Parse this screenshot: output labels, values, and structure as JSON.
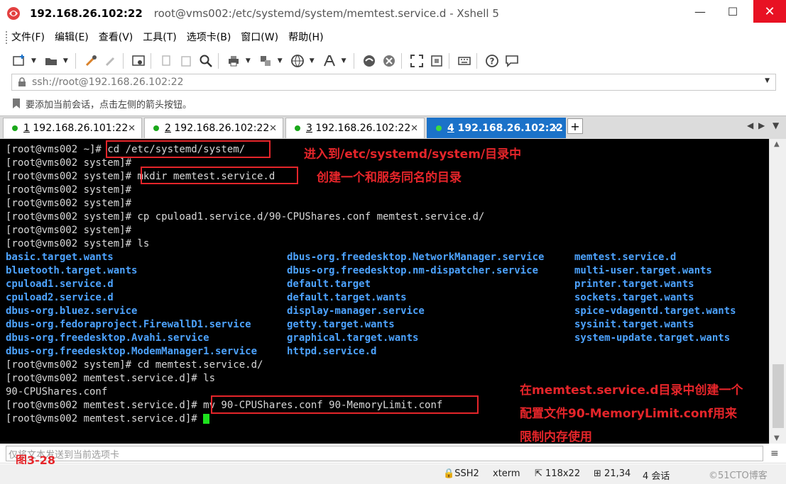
{
  "window": {
    "host": "192.168.26.102:22",
    "title_rest": "root@vms002:/etc/systemd/system/memtest.service.d - Xshell 5",
    "minimize": "—",
    "maximize": "☐",
    "close": "✕"
  },
  "menu": [
    "文件(F)",
    "编辑(E)",
    "查看(V)",
    "工具(T)",
    "选项卡(B)",
    "窗口(W)",
    "帮助(H)"
  ],
  "address": {
    "value": "ssh://root@192.168.26.102:22",
    "lock_icon": "lock-icon"
  },
  "hint": {
    "text": "要添加当前会话，点击左侧的箭头按钮。"
  },
  "tabs": [
    {
      "num": "1",
      "label": "192.168.26.101:22",
      "active": false
    },
    {
      "num": "2",
      "label": "192.168.26.102:22",
      "active": false
    },
    {
      "num": "3",
      "label": "192.168.26.102:22",
      "active": false
    },
    {
      "num": "4",
      "label": "192.168.26.102:22",
      "active": true
    }
  ],
  "terminal": {
    "lines": [
      {
        "text": "[root@vms002 ~]# cd /etc/systemd/system/"
      },
      {
        "text": "[root@vms002 system]#"
      },
      {
        "text": "[root@vms002 system]# mkdir memtest.service.d"
      },
      {
        "text": "[root@vms002 system]#"
      },
      {
        "text": "[root@vms002 system]#"
      },
      {
        "text": "[root@vms002 system]# cp cpuload1.service.d/90-CPUShares.conf memtest.service.d/"
      },
      {
        "text": "[root@vms002 system]#"
      },
      {
        "text": "[root@vms002 system]# ls"
      }
    ],
    "ls_columns": [
      [
        "basic.target.wants",
        "bluetooth.target.wants",
        "cpuload1.service.d",
        "cpuload2.service.d",
        "dbus-org.bluez.service",
        "dbus-org.fedoraproject.FirewallD1.service",
        "dbus-org.freedesktop.Avahi.service",
        "dbus-org.freedesktop.ModemManager1.service"
      ],
      [
        "dbus-org.freedesktop.NetworkManager.service",
        "dbus-org.freedesktop.nm-dispatcher.service",
        "default.target",
        "default.target.wants",
        "display-manager.service",
        "getty.target.wants",
        "graphical.target.wants",
        "httpd.service.d"
      ],
      [
        "memtest.service.d",
        "multi-user.target.wants",
        "printer.target.wants",
        "sockets.target.wants",
        "spice-vdagentd.target.wants",
        "sysinit.target.wants",
        "system-update.target.wants",
        ""
      ]
    ],
    "after_lines": [
      {
        "text": "[root@vms002 system]# cd memtest.service.d/"
      },
      {
        "text": "[root@vms002 memtest.service.d]# ls"
      },
      {
        "text": "90-CPUShares.conf"
      },
      {
        "text": "[root@vms002 memtest.service.d]# mv 90-CPUShares.conf 90-MemoryLimit.conf"
      },
      {
        "text": "[root@vms002 memtest.service.d]# "
      }
    ],
    "annotations": {
      "a1": "进入到/etc/systemd/system/目录中",
      "a2": "创建一个和服务同名的目录",
      "a3_l1": "在memtest.service.d目录中创建一个",
      "a3_l2": "配置文件90-MemoryLimit.conf用来",
      "a3_l3": "限制内存使用"
    }
  },
  "sendbar": {
    "placeholder": "仅将文本发送到当前选项卡",
    "figure_label": "图3-28"
  },
  "status": {
    "protocol": "SSH2",
    "term": "xterm",
    "size": "118x22",
    "cursor_pos": "21,34",
    "sessions": "4 会话",
    "watermark": "©51CTO博客"
  },
  "colors": {
    "accent_tab": "#1b72c9",
    "annotation": "#e5252a",
    "dir": "#4da3ff",
    "cursor": "#1de21d"
  }
}
